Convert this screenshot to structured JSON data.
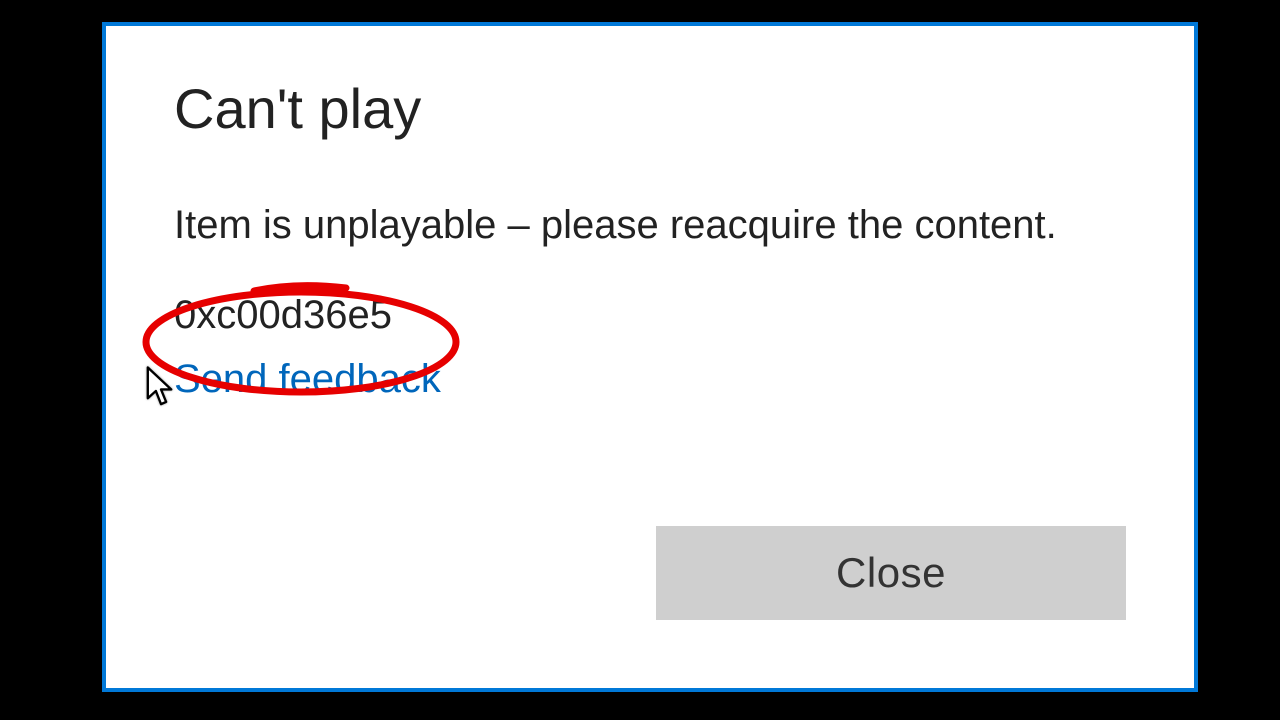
{
  "dialog": {
    "title": "Can't play",
    "message": "Item is unplayable – please reacquire the content.",
    "error_code": "0xc00d36e5",
    "feedback_link": "Send feedback",
    "close_label": "Close"
  },
  "colors": {
    "accent": "#0078d7",
    "link": "#0066bb",
    "annotation": "#e60000",
    "button_bg": "#cfcfcf"
  }
}
